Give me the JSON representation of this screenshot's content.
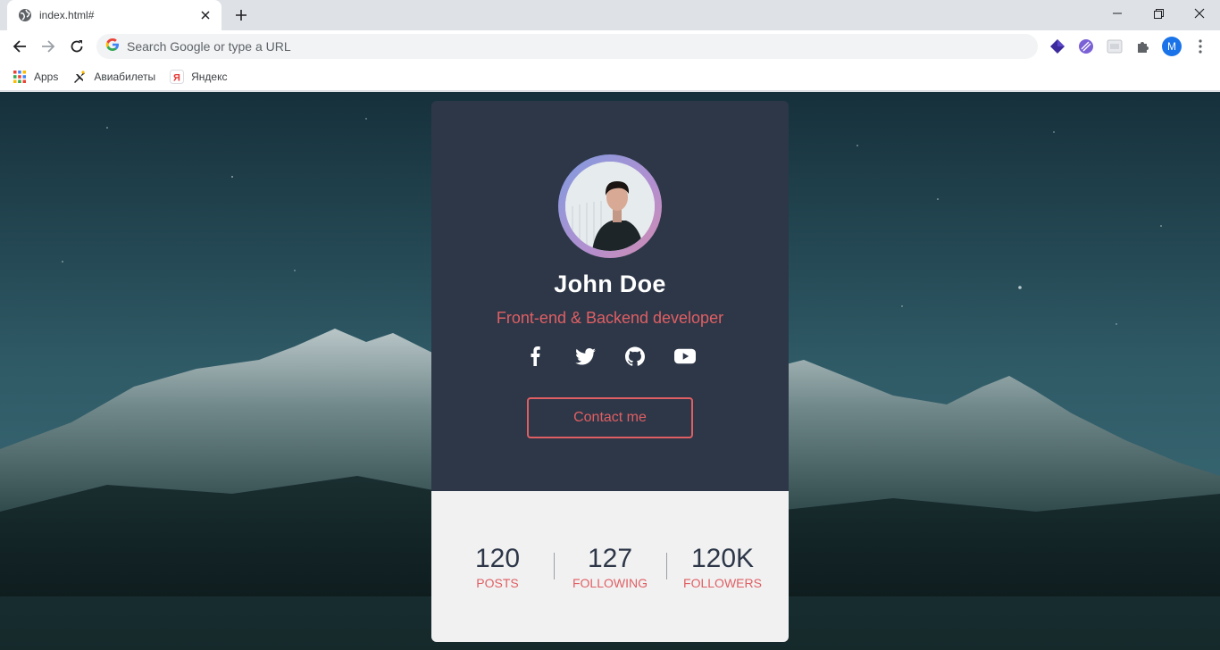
{
  "browser": {
    "tab": {
      "title": "index.html#"
    },
    "omnibox": {
      "placeholder": "Search Google or type a URL"
    },
    "profile_initial": "M",
    "bookmarks": [
      {
        "label": "Apps",
        "icon": "apps-grid-icon"
      },
      {
        "label": "Авиабилеты",
        "icon": "plane-icon"
      },
      {
        "label": "Яндекс",
        "icon": "yandex-icon"
      }
    ],
    "extensions": [
      "purple-diamond-icon",
      "striped-circle-icon",
      "grey-square-icon",
      "puzzle-icon"
    ]
  },
  "profile_card": {
    "name": "John Doe",
    "role": "Front-end & Backend developer",
    "social": [
      "facebook-icon",
      "twitter-icon",
      "github-icon",
      "youtube-icon"
    ],
    "contact_label": "Contact me",
    "stats": [
      {
        "value": "120",
        "label": "POSTS"
      },
      {
        "value": "127",
        "label": "FOLLOWING"
      },
      {
        "value": "120K",
        "label": "FOLLOWERS"
      }
    ]
  },
  "colors": {
    "accent": "#e05f63",
    "card_dark": "#2d3748",
    "card_light": "#f1f1f2",
    "browser_frame": "#dee1e6"
  }
}
